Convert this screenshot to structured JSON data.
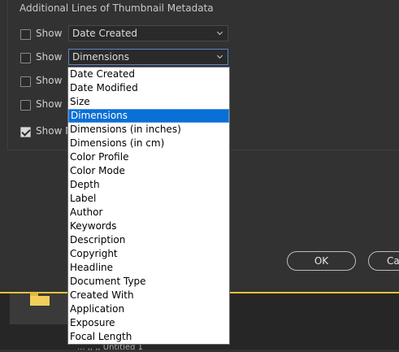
{
  "section": {
    "title": "Additional Lines of Thumbnail Metadata"
  },
  "rows": [
    {
      "show_label": "Show",
      "value": "Date Created",
      "checked": false
    },
    {
      "show_label": "Show",
      "value": "Dimensions",
      "checked": false
    },
    {
      "show_label": "Show",
      "checked": false
    },
    {
      "show_label": "Show",
      "checked": false
    },
    {
      "show_label": "Show M",
      "checked": true
    }
  ],
  "dropdown": {
    "selected": "Dimensions",
    "options": [
      "Date Created",
      "Date Modified",
      "Size",
      "Dimensions",
      "Dimensions (in inches)",
      "Dimensions (in cm)",
      "Color Profile",
      "Color Mode",
      "Depth",
      "Label",
      "Author",
      "Keywords",
      "Description",
      "Copyright",
      "Headline",
      "Document Type",
      "Created With",
      "Application",
      "Exposure",
      "Focal Length"
    ]
  },
  "buttons": {
    "ok": "OK",
    "cancel_partial": "Ca"
  },
  "bottom": {
    "partial_text": "...  ,,  ,,  Untitled 1"
  },
  "colors": {
    "accent_selection": "#0a6fd6",
    "status_bar": "#e8c33a",
    "folder": "#f2cf5a"
  }
}
